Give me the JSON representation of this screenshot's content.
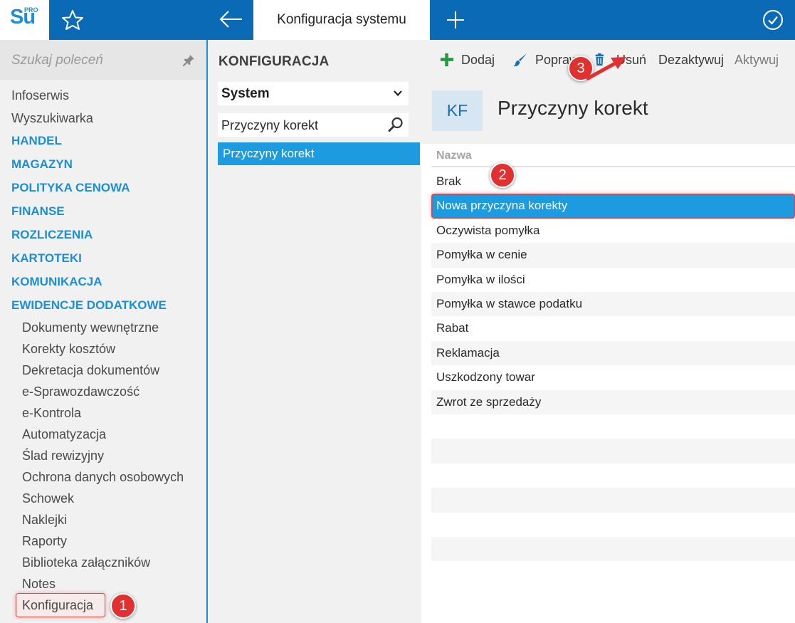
{
  "app": {
    "logo_text": "Su",
    "logo_badge": "PRO"
  },
  "topbar": {
    "active_tab": "Konfiguracja systemu",
    "icons": [
      "star-icon",
      "arrow-left-icon",
      "plus-icon",
      "check-circle-icon"
    ]
  },
  "sidebar": {
    "search_placeholder": "Szukaj poleceń",
    "items": [
      "Infoserwis",
      "Wyszukiwarka"
    ],
    "categories": [
      "HANDEL",
      "MAGAZYN",
      "POLITYKA CENOWA",
      "FINANSE",
      "ROZLICZENIA",
      "KARTOTEKI",
      "KOMUNIKACJA",
      "EWIDENCJE DODATKOWE"
    ],
    "subitems": [
      "Dokumenty wewnętrzne",
      "Korekty kosztów",
      "Dekretacja dokumentów",
      "e-Sprawozdawczość",
      "e-Kontrola",
      "Automatyzacja",
      "Ślad rewizyjny",
      "Ochrona danych osobowych",
      "Schowek",
      "Naklejki",
      "Raporty",
      "Biblioteka załączników",
      "Notes"
    ],
    "selected_item": "Konfiguracja"
  },
  "middle": {
    "title": "KONFIGURACJA",
    "select_value": "System",
    "search_value": "Przyczyny korekt",
    "list_items": [
      "Przyczyny korekt"
    ]
  },
  "toolbar": {
    "add_label": "Dodaj",
    "edit_label": "Popraw",
    "delete_label": "Usuń",
    "deactivate_label": "Dezaktywuj",
    "activate_label": "Aktywuj"
  },
  "content": {
    "badge": "KF",
    "title": "Przyczyny korekt",
    "column_header": "Nazwa",
    "rows": [
      "Brak",
      "Nowa przyczyna korekty",
      "Oczywista pomyłka",
      "Pomyłka w cenie",
      "Pomyłka w ilości",
      "Pomyłka w stawce podatku",
      "Rabat",
      "Reklamacja",
      "Uszkodzony towar",
      "Zwrot ze sprzedaży"
    ],
    "selected_row": 1,
    "empty_rows": 7
  },
  "annotations": {
    "marker_1": "1",
    "marker_2": "2",
    "marker_3": "3"
  },
  "colors": {
    "brand_blue": "#0a6ab5",
    "accent_blue": "#1c9be0",
    "category_blue": "#1c8ed8",
    "highlight_red": "#e04848",
    "add_green": "#1f9d3a"
  }
}
